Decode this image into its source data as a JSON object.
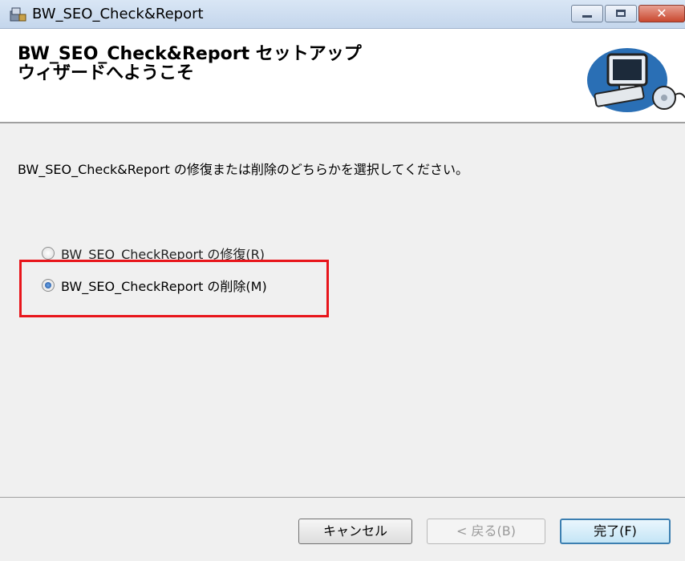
{
  "window": {
    "title": "BW_SEO_Check&Report",
    "close_glyph": "✕"
  },
  "banner": {
    "title": "BW_SEO_Check&Report セットアップ ウィザードへようこそ"
  },
  "content": {
    "instruction": "BW_SEO_Check&Report の修復または削除のどちらかを選択してください。",
    "options": [
      {
        "label": "BW_SEO_CheckReport の修復(R)",
        "selected": false
      },
      {
        "label": "BW_SEO_CheckReport の削除(M)",
        "selected": true
      }
    ]
  },
  "footer": {
    "cancel": "キャンセル",
    "back": "< 戻る(B)",
    "finish": "完了(F)"
  },
  "colors": {
    "highlight": "#e8151b",
    "accent": "#3c7fb1"
  }
}
